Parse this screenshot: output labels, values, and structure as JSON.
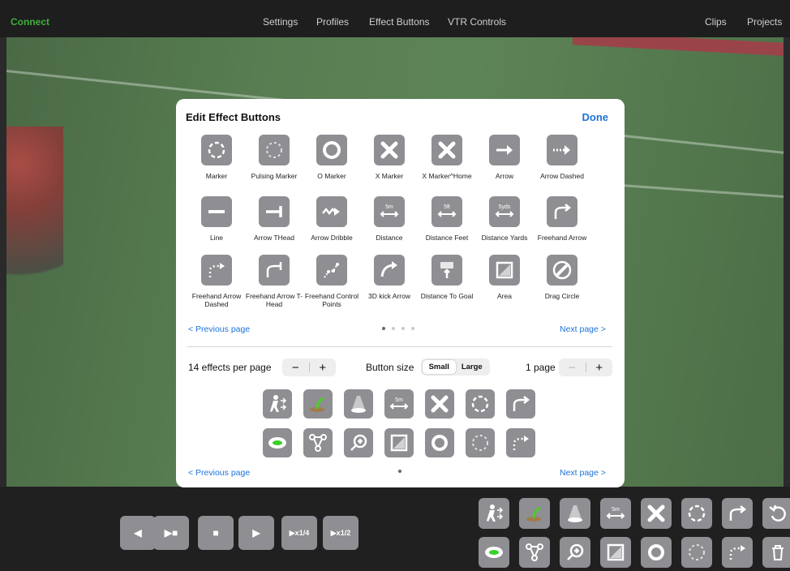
{
  "topbar": {
    "brand": "Connect",
    "nav": [
      "Settings",
      "Profiles",
      "Effect Buttons",
      "VTR Controls"
    ],
    "right": [
      "Clips",
      "Projects"
    ]
  },
  "dialog": {
    "title": "Edit Effect Buttons",
    "done_label": "Done",
    "effects": [
      {
        "label": "Marker",
        "icon": "marker-icon"
      },
      {
        "label": "Pulsing Marker",
        "icon": "pulsing-marker-icon"
      },
      {
        "label": "O Marker",
        "icon": "o-marker-icon"
      },
      {
        "label": "X Marker",
        "icon": "x-marker-icon"
      },
      {
        "label": "X Marker^Home",
        "icon": "x-marker-home-icon"
      },
      {
        "label": "Arrow",
        "icon": "arrow-icon"
      },
      {
        "label": "Arrow Dashed",
        "icon": "arrow-dashed-icon"
      },
      {
        "label": "Line",
        "icon": "line-icon"
      },
      {
        "label": "Arrow THead",
        "icon": "arrow-thead-icon"
      },
      {
        "label": "Arrow Dribble",
        "icon": "arrow-dribble-icon"
      },
      {
        "label": "Distance",
        "icon": "distance-icon",
        "tag": "5m"
      },
      {
        "label": "Distance Feet",
        "icon": "distance-feet-icon",
        "tag": "5ft"
      },
      {
        "label": "Distance Yards",
        "icon": "distance-yards-icon",
        "tag": "5yds"
      },
      {
        "label": "Freehand Arrow",
        "icon": "freehand-arrow-icon"
      },
      {
        "label": "Freehand Arrow Dashed",
        "icon": "freehand-arrow-dashed-icon"
      },
      {
        "label": "Freehand Arrow T-Head",
        "icon": "freehand-arrow-thead-icon"
      },
      {
        "label": "Freehand Control Points",
        "icon": "freehand-control-points-icon"
      },
      {
        "label": "3D kick Arrow",
        "icon": "kick-arrow-icon"
      },
      {
        "label": "Distance To Goal",
        "icon": "distance-to-goal-icon"
      },
      {
        "label": "Area",
        "icon": "area-icon"
      },
      {
        "label": "Drag Circle",
        "icon": "drag-circle-icon"
      }
    ],
    "pager_top": {
      "prev": "< Previous page",
      "next": "Next page >",
      "pages": 4,
      "current": 1
    },
    "settings": {
      "per_page_label": "14 effects per page",
      "minus": "−",
      "plus": "+",
      "button_size_label": "Button size",
      "size_options": [
        "Small",
        "Large"
      ],
      "size_selected": "Small",
      "pages_label": "1 page"
    },
    "pager_bottom": {
      "prev": "< Previous page",
      "next": "Next page >",
      "pages": 1,
      "current": 1
    }
  },
  "vtr": {
    "buttons": [
      "◀",
      "▶■",
      "■",
      "▶",
      "▶x1/4",
      "▶x1/2"
    ]
  },
  "distance_tag": "5m"
}
